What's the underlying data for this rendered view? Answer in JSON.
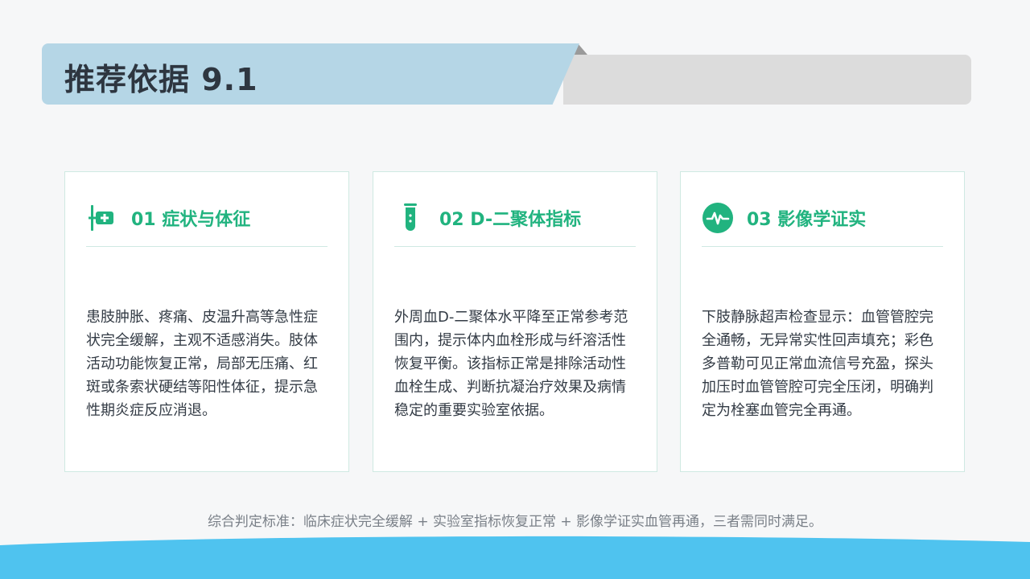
{
  "header": {
    "title": "推荐依据 9.1"
  },
  "cards": [
    {
      "title": "01 症状与体征",
      "icon": "clinic-plus-icon",
      "body": "患肢肿胀、疼痛、皮温升高等急性症状完全缓解，主观不适感消失。肢体活动功能恢复正常，局部无压痛、红斑或条索状硬结等阳性体征，提示急性期炎症反应消退。"
    },
    {
      "title": "02 D-二聚体指标",
      "icon": "test-tube-icon",
      "body": "外周血D-二聚体水平降至正常参考范围内，提示体内血栓形成与纤溶活性恢复平衡。该指标正常是排除活动性血栓生成、判断抗凝治疗效果及病情稳定的重要实验室依据。"
    },
    {
      "title": "03 影像学证实",
      "icon": "pulse-monitor-icon",
      "body": "下肢静脉超声检查显示：血管管腔完全通畅，无异常实性回声填充；彩色多普勒可见正常血流信号充盈，探头加压时血管管腔可完全压闭，明确判定为栓塞血管完全再通。"
    }
  ],
  "footer": {
    "note": "综合判定标准：临床症状完全缓解 + 实验室指标恢复正常 + 影像学证实血管再通，三者需同时满足。"
  },
  "colors": {
    "accent": "#21b37f",
    "title_band": "#b5d6e6",
    "bottom_wave": "#4fc3ef"
  }
}
